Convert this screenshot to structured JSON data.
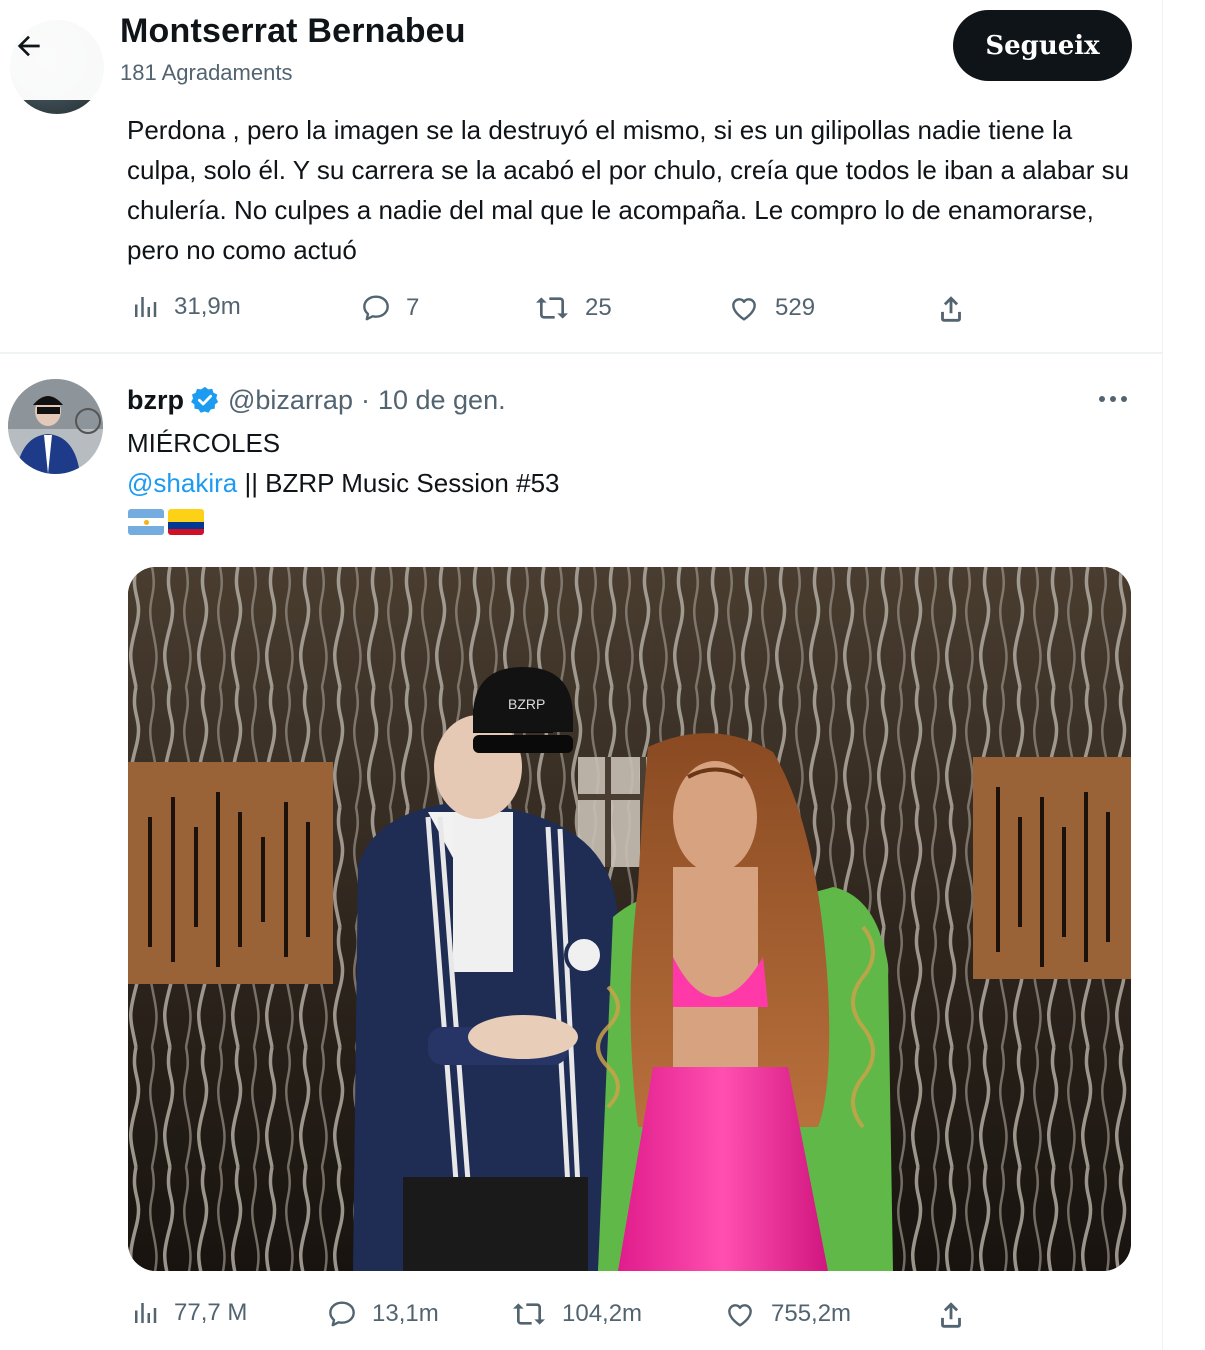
{
  "header": {
    "title": "Montserrat Bernabeu",
    "subtitle": "181 Agradaments",
    "follow_label": "Segueix"
  },
  "tweet1": {
    "text": "Perdona , pero la imagen se la destruyó el mismo, si es un gilipollas nadie tiene la culpa, solo él. Y su carrera se la acabó el por chulo, creía que todos le iban a alabar su chulería. No culpes a nadie del mal que le acompaña. Le compro lo de enamorarse, pero no como actuó",
    "views": "31,9m",
    "replies": "7",
    "retweets": "25",
    "likes": "529"
  },
  "tweet2": {
    "name": "bzrp",
    "handle": "@bizarrap",
    "separator": "·",
    "date": "10 de gen.",
    "line1": "MIÉRCOLES",
    "mention": "@shakira",
    "line2_rest": " || BZRP Music Session #53",
    "flags": [
      "argentina-flag",
      "colombia-flag"
    ],
    "views": "77,7 M",
    "replies": "13,1m",
    "retweets": "104,2m",
    "likes": "755,2m",
    "cap_text": "BZRP"
  },
  "colors": {
    "accent": "#1d9bf0",
    "text_primary": "#0f1419",
    "text_secondary": "#536471",
    "button_dark": "#0f1419"
  },
  "icons": [
    "back-arrow-icon",
    "views-icon",
    "reply-icon",
    "retweet-icon",
    "like-icon",
    "share-icon",
    "verified-badge-icon",
    "more-icon"
  ]
}
